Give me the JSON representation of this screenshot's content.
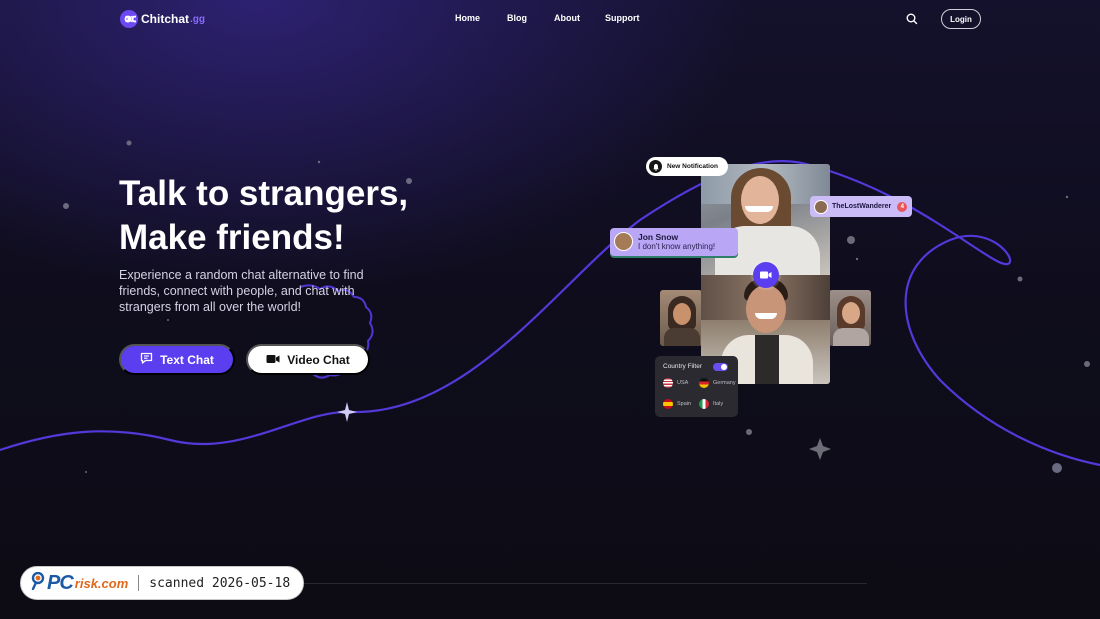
{
  "brand": {
    "name": "Chitchat",
    "suffix": ".gg",
    "accent": "#5b3ef0"
  },
  "nav": {
    "links": [
      "Home",
      "Blog",
      "About",
      "Support"
    ],
    "search_icon": "search-icon",
    "login_label": "Login"
  },
  "hero": {
    "title_line1": "Talk to strangers,",
    "title_line2": "Make friends!",
    "description": "Experience a random chat alternative to find friends, connect with people, and chat with strangers from all over the world!",
    "text_chat_label": "Text Chat",
    "video_chat_label": "Video Chat"
  },
  "collage": {
    "notification_label": "New Notification",
    "chat": {
      "name": "Jon Snow",
      "message": "I don't know anything!"
    },
    "user_tag": {
      "name": "TheLostWanderer",
      "count": "4"
    },
    "country_filter": {
      "title": "Country Filter",
      "enabled": true,
      "countries": [
        "USA",
        "Germany",
        "Spain",
        "Italy"
      ]
    }
  },
  "watermark": {
    "brand_pc": "PC",
    "brand_risk": "risk.com",
    "scan_text": "scanned 2026-05-18"
  }
}
